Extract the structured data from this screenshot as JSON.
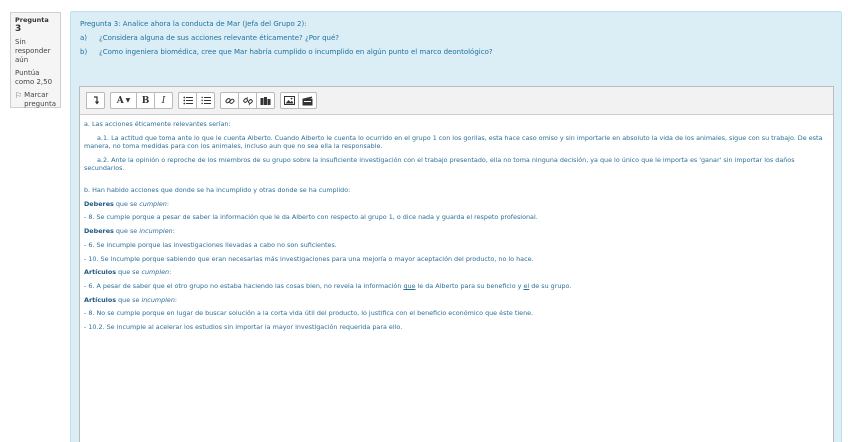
{
  "question_info": {
    "label": "Pregunta",
    "number": "3",
    "state": "Sin responder aún",
    "grade": "Puntúa como 2,50",
    "flag_label": "Marcar pregunta"
  },
  "question_text": {
    "title": "Pregunta 3: Analice ahora la conducta de Mar (Jefa del Grupo 2):",
    "items": [
      {
        "marker": "a)",
        "text": "¿Considera alguna de sus acciones relevante éticamente? ¿Por qué?"
      },
      {
        "marker": "b)",
        "text": "¿Como ingeniera biomédica, cree que Mar habría cumplido o incumplido en algún punto el marco deontológico?"
      }
    ]
  },
  "toolbar": {
    "icons": [
      "collapse-icon",
      "font-style-icon",
      "bold-icon",
      "italic-icon",
      "unordered-list-icon",
      "ordered-list-icon",
      "link-icon",
      "unlink-icon",
      "moodle-media-icon",
      "image-icon",
      "media-icon"
    ],
    "font_button_label": "A",
    "bold_label": "B",
    "italic_label": "I"
  },
  "answer": {
    "a_intro": "a. Las acciones éticamente relevantes serían:",
    "a1": "a.1. La actitud que toma ante lo que le cuenta Alberto. Cuando Alberto le cuenta lo ocurrido en el grupo 1 con los gorilas, esta hace caso omiso y sin importarle en absoluto la vida de los animales, sigue con su trabajo. De esta manera, no toma medidas para con los animales, incluso aun que no sea ella la responsable.",
    "a2": "a.2. Ante la opinión o reproche de los miembros de su grupo sobre la insuficiente investigación con el trabajo presentado, ella no toma ninguna decisión, ya que lo único que le importa es 'ganar' sin importar los daños secundarios.",
    "b_intro": "b. Han habido acciones que donde se ha incumplido y otras donde se ha cumplido:",
    "deberes_label": "Deberes",
    "que_se": " que se ",
    "cumplen": "cumplen",
    "incumplen": "incumplen",
    "punct": ":",
    "line_8_cumple": "- 8. Se cumple porque a pesar de saber la información que le da Alberto con respecto al grupo 1, o dice nada y guarda el respeto profesional.",
    "line_6_incumple": "- 6. Se incumple porque las investigaciones llevadas a cabo no son suficientes.",
    "line_10_incumple": "- 10. Se incumple porque sabiendo que eran necesarias más investigaciones para una  mejoría o mayor aceptación del producto, no lo hace.",
    "articulos_label": "Artículos",
    "line_6a_part1": "- 6. A pesar de saber que el otro grupo no estaba haciendo las cosas bien, no revela la información ",
    "line_6a_que": "que",
    "line_6a_part2": " le da Alberto para su beneficio y ",
    "line_6a_el": "el",
    "line_6a_part3": " de su grupo.",
    "line_8_no_cumple": "- 8. No se cumple porque en lugar de buscar solución a la corta vida útil del producto, lo justifica con el beneficio económico que éste tiene.",
    "line_102": "- 10.2. Se incumple al acelerar los estudios sin importar la mayor investigación requerida para ello."
  }
}
